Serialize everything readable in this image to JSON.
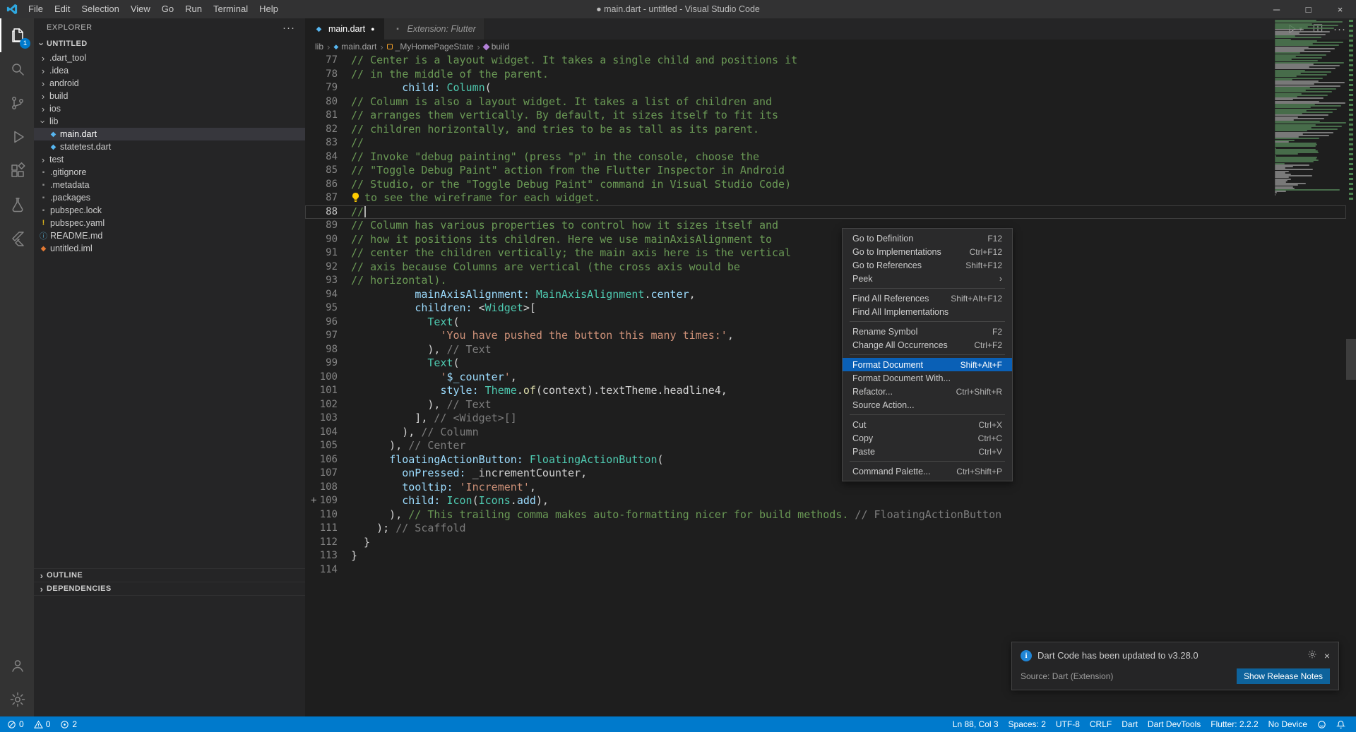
{
  "colors": {
    "accent": "#007ACC",
    "menuHighlight": "#0A60B6",
    "button": "#0E639C",
    "dartBlue": "#57B6F0"
  },
  "titlebar": {
    "menus": [
      "File",
      "Edit",
      "Selection",
      "View",
      "Go",
      "Run",
      "Terminal",
      "Help"
    ],
    "title": "● main.dart - untitled - Visual Studio Code",
    "window_controls": {
      "minimize": "─",
      "maximize": "□",
      "close": "×"
    }
  },
  "activity": {
    "explorer_badge": "1"
  },
  "sidebar": {
    "header": "EXPLORER",
    "more": "···",
    "section": "UNTITLED",
    "tree": [
      {
        "label": ".dart_tool",
        "kind": "folder",
        "expanded": false
      },
      {
        "label": ".idea",
        "kind": "folder",
        "expanded": false
      },
      {
        "label": "android",
        "kind": "folder",
        "expanded": false
      },
      {
        "label": "build",
        "kind": "folder",
        "expanded": false
      },
      {
        "label": "ios",
        "kind": "folder",
        "expanded": false
      },
      {
        "label": "lib",
        "kind": "folder",
        "expanded": true
      },
      {
        "label": "main.dart",
        "kind": "file",
        "icon": "dart",
        "depth": 1,
        "selected": true
      },
      {
        "label": "statetest.dart",
        "kind": "file",
        "icon": "dart",
        "depth": 1
      },
      {
        "label": "test",
        "kind": "folder",
        "expanded": false
      },
      {
        "label": ".gitignore",
        "kind": "file",
        "icon": "generic"
      },
      {
        "label": ".metadata",
        "kind": "file",
        "icon": "generic"
      },
      {
        "label": ".packages",
        "kind": "file",
        "icon": "generic"
      },
      {
        "label": "pubspec.lock",
        "kind": "file",
        "icon": "generic"
      },
      {
        "label": "pubspec.yaml",
        "kind": "file",
        "icon": "yaml"
      },
      {
        "label": "README.md",
        "kind": "file",
        "icon": "info"
      },
      {
        "label": "untitled.iml",
        "kind": "file",
        "icon": "xml"
      }
    ],
    "bottom": [
      "OUTLINE",
      "DEPENDENCIES"
    ]
  },
  "tabs": [
    {
      "label": "main.dart",
      "icon": "dart",
      "modified": true,
      "active": true,
      "italic": false
    },
    {
      "label": "Extension: Flutter",
      "icon": "generic",
      "modified": false,
      "active": false,
      "italic": true
    }
  ],
  "breadcrumbs": [
    {
      "label": "lib",
      "icon": null
    },
    {
      "label": "main.dart",
      "icon": "dart"
    },
    {
      "label": "_MyHomePageState",
      "icon": "class"
    },
    {
      "label": "build",
      "icon": "method"
    }
  ],
  "editor": {
    "lines": [
      {
        "n": 77,
        "seg": [
          [
            "// Center is a layout widget. It takes a single child and positions it",
            "cm"
          ]
        ]
      },
      {
        "n": 78,
        "seg": [
          [
            "// in the middle of the parent.",
            "cm"
          ]
        ]
      },
      {
        "n": 79,
        "seg": [
          [
            "        ",
            "pl"
          ],
          [
            "child: ",
            "pr"
          ],
          [
            "Column",
            "ty"
          ],
          [
            "(",
            "pl"
          ]
        ]
      },
      {
        "n": 80,
        "seg": [
          [
            "// Column is also a layout widget. It takes a list of children and",
            "cm"
          ]
        ]
      },
      {
        "n": 81,
        "seg": [
          [
            "// arranges them vertically. By default, it sizes itself to fit its",
            "cm"
          ]
        ]
      },
      {
        "n": 82,
        "seg": [
          [
            "// children horizontally, and tries to be as tall as its parent.",
            "cm"
          ]
        ]
      },
      {
        "n": 83,
        "seg": [
          [
            "//",
            "cm"
          ]
        ]
      },
      {
        "n": 84,
        "seg": [
          [
            "// Invoke \"debug painting\" (press \"p\" in the console, choose the",
            "cm"
          ]
        ]
      },
      {
        "n": 85,
        "seg": [
          [
            "// \"Toggle Debug Paint\" action from the Flutter Inspector in Android",
            "cm"
          ]
        ]
      },
      {
        "n": 86,
        "seg": [
          [
            "// Studio, or the \"Toggle Debug Paint\" command in Visual Studio Code)",
            "cm"
          ]
        ]
      },
      {
        "n": 87,
        "bulb": true,
        "seg": [
          [
            "to see the wireframe for each widget.",
            "cm"
          ]
        ]
      },
      {
        "n": 88,
        "cur": true,
        "seg": [
          [
            "//",
            "cm"
          ]
        ]
      },
      {
        "n": 89,
        "seg": [
          [
            "// Column has various properties to control how it sizes itself and",
            "cm"
          ]
        ]
      },
      {
        "n": 90,
        "seg": [
          [
            "// how it positions its children. Here we use mainAxisAlignment to",
            "cm"
          ]
        ]
      },
      {
        "n": 91,
        "seg": [
          [
            "// center the children vertically; the main axis here is the vertical",
            "cm"
          ]
        ]
      },
      {
        "n": 92,
        "seg": [
          [
            "// axis because Columns are vertical (the cross axis would be",
            "cm"
          ]
        ]
      },
      {
        "n": 93,
        "seg": [
          [
            "// horizontal).",
            "cm"
          ]
        ]
      },
      {
        "n": 94,
        "seg": [
          [
            "          ",
            "pl"
          ],
          [
            "mainAxisAlignment: ",
            "pr"
          ],
          [
            "MainAxisAlignment",
            "ty"
          ],
          [
            ".",
            "pl"
          ],
          [
            "center",
            "pr"
          ],
          [
            ",",
            "pl"
          ]
        ]
      },
      {
        "n": 95,
        "seg": [
          [
            "          ",
            "pl"
          ],
          [
            "children: ",
            "pr"
          ],
          [
            "<",
            "pl"
          ],
          [
            "Widget",
            "ty"
          ],
          [
            ">[",
            "pl"
          ]
        ]
      },
      {
        "n": 96,
        "seg": [
          [
            "            ",
            "pl"
          ],
          [
            "Text",
            "ty"
          ],
          [
            "(",
            "pl"
          ]
        ]
      },
      {
        "n": 97,
        "seg": [
          [
            "              ",
            "pl"
          ],
          [
            "'You have pushed the button this many times:'",
            "st"
          ],
          [
            ",",
            "pl"
          ]
        ]
      },
      {
        "n": 98,
        "seg": [
          [
            "            ),",
            "pl"
          ],
          [
            " // Text",
            "lb"
          ]
        ]
      },
      {
        "n": 99,
        "seg": [
          [
            "            ",
            "pl"
          ],
          [
            "Text",
            "ty"
          ],
          [
            "(",
            "pl"
          ]
        ]
      },
      {
        "n": 100,
        "seg": [
          [
            "              ",
            "pl"
          ],
          [
            "'",
            "st"
          ],
          [
            "$_counter",
            "ip"
          ],
          [
            "'",
            "st"
          ],
          [
            ",",
            "pl"
          ]
        ]
      },
      {
        "n": 101,
        "seg": [
          [
            "              ",
            "pl"
          ],
          [
            "style: ",
            "pr"
          ],
          [
            "Theme",
            "ty"
          ],
          [
            ".",
            "pl"
          ],
          [
            "of",
            "fn"
          ],
          [
            "(context).textTheme.headline4,",
            "pl"
          ]
        ]
      },
      {
        "n": 102,
        "seg": [
          [
            "            ),",
            "pl"
          ],
          [
            " // Text",
            "lb"
          ]
        ]
      },
      {
        "n": 103,
        "seg": [
          [
            "          ],",
            "pl"
          ],
          [
            " // <Widget>[]",
            "lb"
          ]
        ]
      },
      {
        "n": 104,
        "seg": [
          [
            "        ),",
            "pl"
          ],
          [
            " // Column",
            "lb"
          ]
        ]
      },
      {
        "n": 105,
        "seg": [
          [
            "      ),",
            "pl"
          ],
          [
            " // Center",
            "lb"
          ]
        ]
      },
      {
        "n": 106,
        "seg": [
          [
            "      ",
            "pl"
          ],
          [
            "floatingActionButton: ",
            "pr"
          ],
          [
            "FloatingActionButton",
            "ty"
          ],
          [
            "(",
            "pl"
          ]
        ]
      },
      {
        "n": 107,
        "seg": [
          [
            "        ",
            "pl"
          ],
          [
            "onPressed: ",
            "pr"
          ],
          [
            "_incrementCounter,",
            "pl"
          ]
        ]
      },
      {
        "n": 108,
        "seg": [
          [
            "        ",
            "pl"
          ],
          [
            "tooltip: ",
            "pr"
          ],
          [
            "'Increment'",
            "st"
          ],
          [
            ",",
            "pl"
          ]
        ]
      },
      {
        "n": 109,
        "plus": true,
        "seg": [
          [
            "        ",
            "pl"
          ],
          [
            "child: ",
            "pr"
          ],
          [
            "Icon",
            "ty"
          ],
          [
            "(",
            "pl"
          ],
          [
            "Icons",
            "ty"
          ],
          [
            ".",
            "pl"
          ],
          [
            "add",
            "pr"
          ],
          [
            "),",
            "pl"
          ]
        ]
      },
      {
        "n": 110,
        "seg": [
          [
            "      ), ",
            "pl"
          ],
          [
            "// This trailing comma makes auto-formatting nicer for build methods.",
            "cm"
          ],
          [
            " // FloatingActionButton",
            "lb"
          ]
        ]
      },
      {
        "n": 111,
        "seg": [
          [
            "    );",
            "pl"
          ],
          [
            " // Scaffold",
            "lb"
          ]
        ]
      },
      {
        "n": 112,
        "seg": [
          [
            "  }",
            "pl"
          ]
        ]
      },
      {
        "n": 113,
        "seg": [
          [
            "}",
            "pl"
          ]
        ]
      },
      {
        "n": 114,
        "seg": []
      }
    ],
    "total_lines": 114
  },
  "context_menu": {
    "groups": [
      [
        {
          "label": "Go to Definition",
          "key": "F12"
        },
        {
          "label": "Go to Implementations",
          "key": "Ctrl+F12"
        },
        {
          "label": "Go to References",
          "key": "Shift+F12"
        },
        {
          "label": "Peek",
          "key": "",
          "submenu": true
        }
      ],
      [
        {
          "label": "Find All References",
          "key": "Shift+Alt+F12"
        },
        {
          "label": "Find All Implementations",
          "key": ""
        }
      ],
      [
        {
          "label": "Rename Symbol",
          "key": "F2"
        },
        {
          "label": "Change All Occurrences",
          "key": "Ctrl+F2"
        }
      ],
      [
        {
          "label": "Format Document",
          "key": "Shift+Alt+F",
          "highlight": true
        },
        {
          "label": "Format Document With...",
          "key": ""
        },
        {
          "label": "Refactor...",
          "key": "Ctrl+Shift+R"
        },
        {
          "label": "Source Action...",
          "key": ""
        }
      ],
      [
        {
          "label": "Cut",
          "key": "Ctrl+X"
        },
        {
          "label": "Copy",
          "key": "Ctrl+C"
        },
        {
          "label": "Paste",
          "key": "Ctrl+V"
        }
      ],
      [
        {
          "label": "Command Palette...",
          "key": "Ctrl+Shift+P"
        }
      ]
    ]
  },
  "notification": {
    "message": "Dart Code has been updated to v3.28.0",
    "source": "Source: Dart (Extension)",
    "button": "Show Release Notes"
  },
  "statusbar": {
    "left": [
      {
        "icon": "error",
        "text": "0"
      },
      {
        "icon": "warning",
        "text": "0"
      },
      {
        "icon": "circle",
        "text": "2"
      }
    ],
    "right": [
      "Ln 88, Col 3",
      "Spaces: 2",
      "UTF-8",
      "CRLF",
      "Dart",
      "Dart DevTools",
      "Flutter: 2.2.2",
      "No Device"
    ]
  }
}
